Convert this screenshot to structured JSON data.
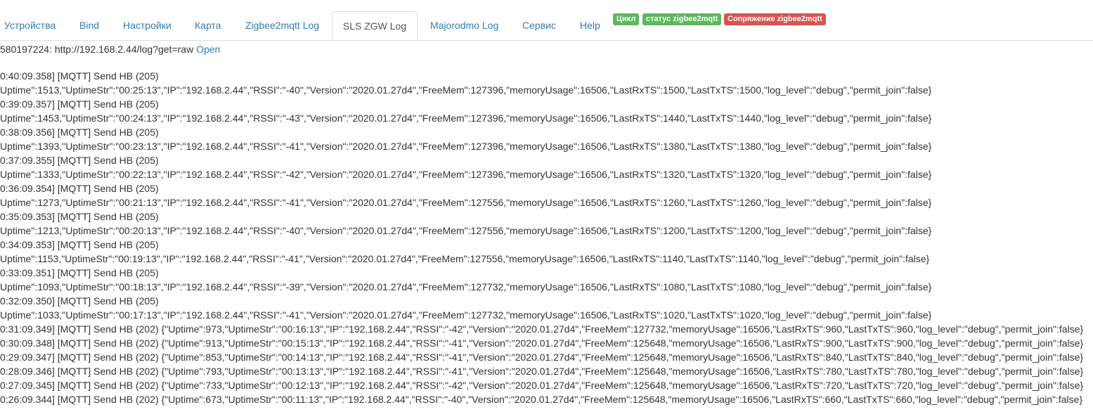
{
  "tabs": [
    {
      "label": "Устройства",
      "active": false
    },
    {
      "label": "Bind",
      "active": false
    },
    {
      "label": "Настройки",
      "active": false
    },
    {
      "label": "Карта",
      "active": false
    },
    {
      "label": "Zigbee2mqtt Log",
      "active": false
    },
    {
      "label": "SLS ZGW Log",
      "active": true
    },
    {
      "label": "Majorodmo Log",
      "active": false
    },
    {
      "label": "Сервис",
      "active": false
    },
    {
      "label": "Help",
      "active": false
    }
  ],
  "badges": [
    {
      "label": "Цикл",
      "color": "#5cb85c"
    },
    {
      "label": "статус zigbee2mqtt",
      "color": "#5cb85c"
    },
    {
      "label": "Сопряжение zigbee2mqtt",
      "color": "#d9534f"
    }
  ],
  "log_header": {
    "prefix": "580197224: http://192.168.2.44/log?get=raw",
    "open_link": "Open"
  },
  "log_lines": [
    "0:40:09.358] [MQTT] Send HB (205)",
    "Uptime\":1513,\"UptimeStr\":\"00:25:13\",\"IP\":\"192.168.2.44\",\"RSSI\":\"-40\",\"Version\":\"2020.01.27d4\",\"FreeMem\":127396,\"memoryUsage\":16506,\"LastRxTS\":1500,\"LastTxTS\":1500,\"log_level\":\"debug\",\"permit_join\":false}",
    "0:39:09.357] [MQTT] Send HB (205)",
    "Uptime\":1453,\"UptimeStr\":\"00:24:13\",\"IP\":\"192.168.2.44\",\"RSSI\":\"-43\",\"Version\":\"2020.01.27d4\",\"FreeMem\":127396,\"memoryUsage\":16506,\"LastRxTS\":1440,\"LastTxTS\":1440,\"log_level\":\"debug\",\"permit_join\":false}",
    "0:38:09.356] [MQTT] Send HB (205)",
    "Uptime\":1393,\"UptimeStr\":\"00:23:13\",\"IP\":\"192.168.2.44\",\"RSSI\":\"-41\",\"Version\":\"2020.01.27d4\",\"FreeMem\":127396,\"memoryUsage\":16506,\"LastRxTS\":1380,\"LastTxTS\":1380,\"log_level\":\"debug\",\"permit_join\":false}",
    "0:37:09.355] [MQTT] Send HB (205)",
    "Uptime\":1333,\"UptimeStr\":\"00:22:13\",\"IP\":\"192.168.2.44\",\"RSSI\":\"-42\",\"Version\":\"2020.01.27d4\",\"FreeMem\":127396,\"memoryUsage\":16506,\"LastRxTS\":1320,\"LastTxTS\":1320,\"log_level\":\"debug\",\"permit_join\":false}",
    "0:36:09.354] [MQTT] Send HB (205)",
    "Uptime\":1273,\"UptimeStr\":\"00:21:13\",\"IP\":\"192.168.2.44\",\"RSSI\":\"-41\",\"Version\":\"2020.01.27d4\",\"FreeMem\":127556,\"memoryUsage\":16506,\"LastRxTS\":1260,\"LastTxTS\":1260,\"log_level\":\"debug\",\"permit_join\":false}",
    "0:35:09.353] [MQTT] Send HB (205)",
    "Uptime\":1213,\"UptimeStr\":\"00:20:13\",\"IP\":\"192.168.2.44\",\"RSSI\":\"-40\",\"Version\":\"2020.01.27d4\",\"FreeMem\":127556,\"memoryUsage\":16506,\"LastRxTS\":1200,\"LastTxTS\":1200,\"log_level\":\"debug\",\"permit_join\":false}",
    "0:34:09.353] [MQTT] Send HB (205)",
    "Uptime\":1153,\"UptimeStr\":\"00:19:13\",\"IP\":\"192.168.2.44\",\"RSSI\":\"-41\",\"Version\":\"2020.01.27d4\",\"FreeMem\":127556,\"memoryUsage\":16506,\"LastRxTS\":1140,\"LastTxTS\":1140,\"log_level\":\"debug\",\"permit_join\":false}",
    "0:33:09.351] [MQTT] Send HB (205)",
    "Uptime\":1093,\"UptimeStr\":\"00:18:13\",\"IP\":\"192.168.2.44\",\"RSSI\":\"-39\",\"Version\":\"2020.01.27d4\",\"FreeMem\":127732,\"memoryUsage\":16506,\"LastRxTS\":1080,\"LastTxTS\":1080,\"log_level\":\"debug\",\"permit_join\":false}",
    "0:32:09.350] [MQTT] Send HB (205)",
    "Uptime\":1033,\"UptimeStr\":\"00:17:13\",\"IP\":\"192.168.2.44\",\"RSSI\":\"-41\",\"Version\":\"2020.01.27d4\",\"FreeMem\":127732,\"memoryUsage\":16506,\"LastRxTS\":1020,\"LastTxTS\":1020,\"log_level\":\"debug\",\"permit_join\":false}",
    "0:31:09.349] [MQTT] Send HB (202) {\"Uptime\":973,\"UptimeStr\":\"00:16:13\",\"IP\":\"192.168.2.44\",\"RSSI\":\"-42\",\"Version\":\"2020.01.27d4\",\"FreeMem\":127732,\"memoryUsage\":16506,\"LastRxTS\":960,\"LastTxTS\":960,\"log_level\":\"debug\",\"permit_join\":false}",
    "0:30:09.348] [MQTT] Send HB (202) {\"Uptime\":913,\"UptimeStr\":\"00:15:13\",\"IP\":\"192.168.2.44\",\"RSSI\":\"-41\",\"Version\":\"2020.01.27d4\",\"FreeMem\":125648,\"memoryUsage\":16506,\"LastRxTS\":900,\"LastTxTS\":900,\"log_level\":\"debug\",\"permit_join\":false}",
    "0:29:09.347] [MQTT] Send HB (202) {\"Uptime\":853,\"UptimeStr\":\"00:14:13\",\"IP\":\"192.168.2.44\",\"RSSI\":\"-41\",\"Version\":\"2020.01.27d4\",\"FreeMem\":125648,\"memoryUsage\":16506,\"LastRxTS\":840,\"LastTxTS\":840,\"log_level\":\"debug\",\"permit_join\":false}",
    "0:28:09.346] [MQTT] Send HB (202) {\"Uptime\":793,\"UptimeStr\":\"00:13:13\",\"IP\":\"192.168.2.44\",\"RSSI\":\"-41\",\"Version\":\"2020.01.27d4\",\"FreeMem\":125648,\"memoryUsage\":16506,\"LastRxTS\":780,\"LastTxTS\":780,\"log_level\":\"debug\",\"permit_join\":false}",
    "0:27:09.345] [MQTT] Send HB (202) {\"Uptime\":733,\"UptimeStr\":\"00:12:13\",\"IP\":\"192.168.2.44\",\"RSSI\":\"-42\",\"Version\":\"2020.01.27d4\",\"FreeMem\":125648,\"memoryUsage\":16506,\"LastRxTS\":720,\"LastTxTS\":720,\"log_level\":\"debug\",\"permit_join\":false}",
    "0:26:09.344] [MQTT] Send HB (202) {\"Uptime\":673,\"UptimeStr\":\"00:11:13\",\"IP\":\"192.168.2.44\",\"RSSI\":\"-40\",\"Version\":\"2020.01.27d4\",\"FreeMem\":125648,\"memoryUsage\":16506,\"LastRxTS\":660,\"LastTxTS\":660,\"log_level\":\"debug\",\"permit_join\":false}"
  ]
}
